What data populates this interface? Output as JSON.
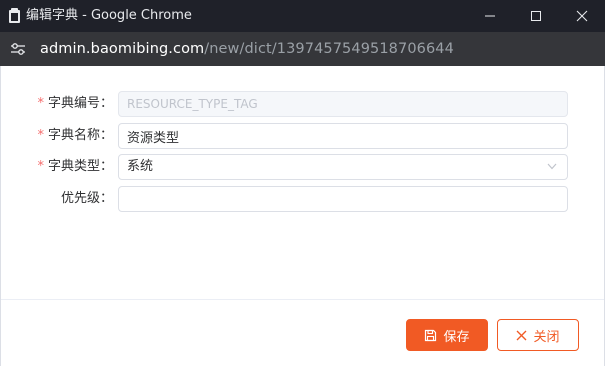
{
  "window": {
    "title": "编辑字典 - Google Chrome",
    "controls": [
      "minimize",
      "maximize",
      "close"
    ]
  },
  "address_bar": {
    "host": "admin.baomibing.com",
    "path": "/new/dict/1397457549518706644"
  },
  "form": {
    "fields": [
      {
        "label": "字典编号：",
        "required": true,
        "value": "RESOURCE_TYPE_TAG",
        "disabled": true
      },
      {
        "label": "字典名称：",
        "required": true,
        "value": "资源类型"
      },
      {
        "label": "字典类型：",
        "required": true,
        "value": "系统",
        "type": "select"
      },
      {
        "label": "优先级：",
        "required": false,
        "value": ""
      }
    ],
    "required_mark": "*"
  },
  "footer": {
    "save_label": "保存",
    "close_label": "关闭"
  },
  "colors": {
    "accent": "#f15a24",
    "required": "#f56c6c",
    "titlebar": "#1f2129",
    "addressbar": "#35363a"
  }
}
